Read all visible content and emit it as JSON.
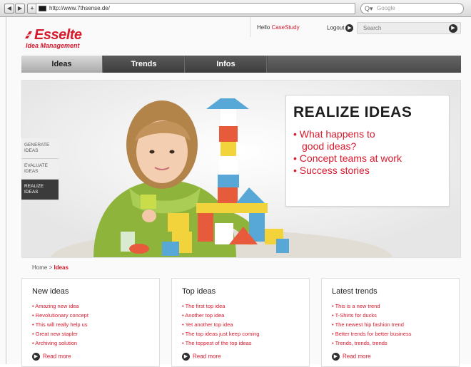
{
  "browser": {
    "url": "http://www.7thsense.de/",
    "search_placeholder": "Google",
    "back_icon": "back-arrow-icon",
    "forward_icon": "forward-arrow-icon",
    "add_icon": "plus-icon"
  },
  "header": {
    "brand": "Esselte",
    "tagline": "Idea Management",
    "hello_prefix": "Hello ",
    "username": "CaseStudy",
    "logout_label": "Logout",
    "search_placeholder": "Search"
  },
  "nav": {
    "tabs": [
      {
        "label": "Ideas",
        "active": true
      },
      {
        "label": "Trends",
        "active": false
      },
      {
        "label": "Infos",
        "active": false
      }
    ]
  },
  "hero": {
    "steps": [
      {
        "label": "GENERATE IDEAS",
        "active": false
      },
      {
        "label": "EVALUATE IDEAS",
        "active": false
      },
      {
        "label": "REALIZE IDEAS",
        "active": true
      }
    ],
    "callout_title": "REALIZE IDEAS",
    "callout_items": [
      "• What happens to",
      "good ideas?",
      "• Concept teams at work",
      "• Success stories"
    ]
  },
  "breadcrumb": {
    "home": "Home",
    "separator": " > ",
    "current": "Ideas"
  },
  "cards": [
    {
      "title": "New ideas",
      "items": [
        "Amazing new idea",
        "Revolutionary concept",
        "This will really help us",
        "Great new stapler",
        "Archiving solution"
      ],
      "read_more": "Read more"
    },
    {
      "title": "Top ideas",
      "items": [
        "The first top idea",
        "Another top idea",
        "Yet another top idea",
        "The top ideas just keep coming",
        "The toppest of the top ideas"
      ],
      "read_more": "Read more"
    },
    {
      "title": "Latest trends",
      "items": [
        "This is a new trend",
        "T-Shirts for ducks",
        "The newest hip fashion trend",
        "Better trends for better business",
        "Trends, trends, trends"
      ],
      "read_more": "Read more"
    }
  ],
  "colors": {
    "brand_red": "#d7192c",
    "nav_dark": "#4a4a4a",
    "text_dark": "#1e1e1e"
  }
}
